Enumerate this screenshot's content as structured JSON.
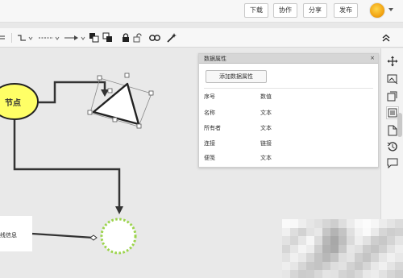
{
  "topbar": {
    "buttons": [
      {
        "label": "下载"
      },
      {
        "label": "协作"
      },
      {
        "label": "分享"
      },
      {
        "label": "发布"
      }
    ]
  },
  "toolbar": {
    "icons": [
      "line-style-icon",
      "connector-icon",
      "dash-line-icon",
      "arrow-line-icon",
      "bring-front-icon",
      "send-back-icon",
      "lock-icon",
      "unlock-icon",
      "group-icon",
      "magic-wand-icon",
      "collapse-icon"
    ]
  },
  "diagram": {
    "node_label": "节点",
    "box_label": "线信息"
  },
  "panel": {
    "title": "数据属性",
    "close": "×",
    "add_button": "添加数据属性",
    "properties": [
      {
        "name": "序号",
        "type": "数值"
      },
      {
        "name": "名称",
        "type": "文本"
      },
      {
        "name": "所有者",
        "type": "文本"
      },
      {
        "name": "连接",
        "type": "链接"
      },
      {
        "name": "便笺",
        "type": "文本"
      }
    ]
  },
  "sidebar": {
    "icons": [
      "navigate-icon",
      "image-icon",
      "layers-icon",
      "data-attributes-icon",
      "page-icon",
      "history-icon",
      "comment-icon"
    ]
  },
  "colors": {
    "node_fill": "#ffff66",
    "dashed_circle": "#9bd44a",
    "connector": "#333333"
  }
}
